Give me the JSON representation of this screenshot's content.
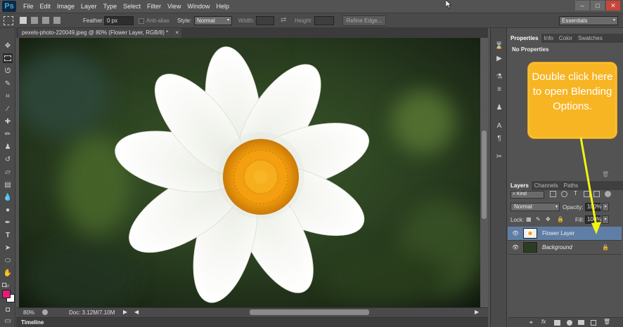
{
  "app": {
    "logo": "Ps"
  },
  "menu": [
    "File",
    "Edit",
    "Image",
    "Layer",
    "Type",
    "Select",
    "Filter",
    "View",
    "Window",
    "Help"
  ],
  "window_controls": {
    "minimize": "–",
    "maximize": "□",
    "close": "✕"
  },
  "options": {
    "feather_label": "Feather:",
    "feather_value": "0 px",
    "antialias_label": "Anti-alias",
    "style_label": "Style:",
    "style_value": "Normal",
    "width_label": "Width:",
    "height_label": "Height:",
    "refine_edge": "Refine Edge...",
    "workspace": "Essentials"
  },
  "document": {
    "tab_title": "pexels-photo-220049.jpeg @ 80% (Flower Layer, RGB/8) *",
    "tab_close": "×",
    "zoom": "80%",
    "doc_size": "Doc: 3.12M/7.10M"
  },
  "timeline": {
    "label": "Timeline"
  },
  "properties": {
    "tabs": [
      "Properties",
      "Info",
      "Color",
      "Swatches"
    ],
    "content": "No Properties"
  },
  "layers_panel": {
    "tabs": [
      "Layers",
      "Channels",
      "Paths"
    ],
    "filter_kind": "Kind",
    "blend_mode": "Normal",
    "opacity_label": "Opacity:",
    "opacity_value": "100%",
    "lock_label": "Lock:",
    "fill_label": "Fill:",
    "fill_value": "100%",
    "layers": [
      {
        "name": "Flower Layer",
        "selected": true
      },
      {
        "name": "Background",
        "selected": false,
        "locked": true
      }
    ]
  },
  "callout": {
    "text": "Double click here to open Blending Options."
  },
  "colors": {
    "foreground": "#e8197c",
    "background": "#ffffff",
    "callout": "#f7b524",
    "arrow": "#f3f312"
  }
}
